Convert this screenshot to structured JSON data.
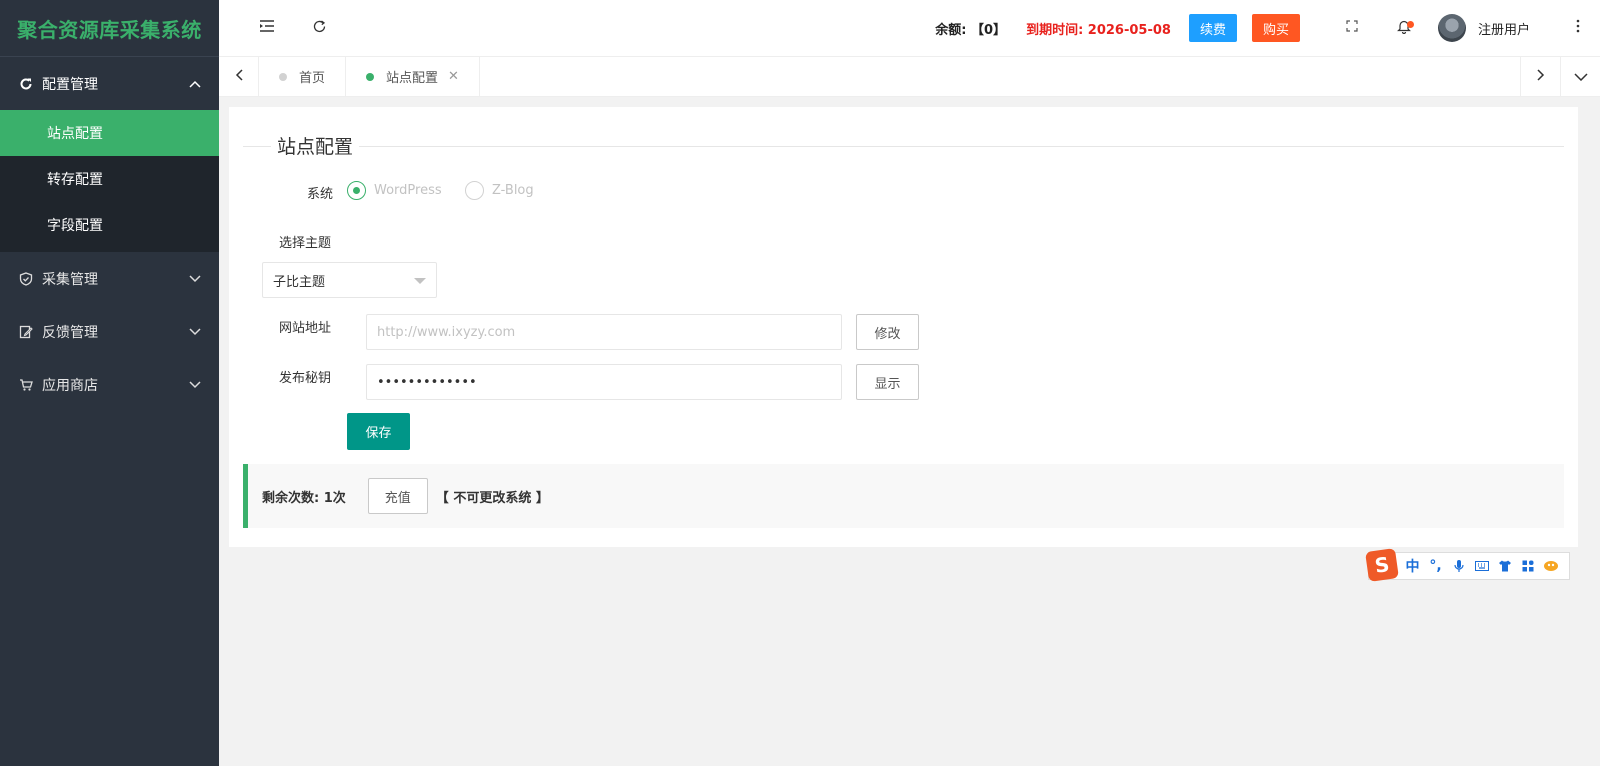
{
  "app": {
    "title": "聚合资源库采集系统"
  },
  "sidebar": {
    "groups": [
      {
        "label": "配置管理",
        "icon": "refresh-icon",
        "expanded": true,
        "items": [
          {
            "label": "站点配置",
            "active": true
          },
          {
            "label": "转存配置",
            "active": false
          },
          {
            "label": "字段配置",
            "active": false
          }
        ]
      },
      {
        "label": "采集管理",
        "icon": "shield-icon",
        "expanded": false
      },
      {
        "label": "反馈管理",
        "icon": "edit-doc-icon",
        "expanded": false
      },
      {
        "label": "应用商店",
        "icon": "cart-icon",
        "expanded": false
      }
    ]
  },
  "header": {
    "balance_text": "余额: 【0】",
    "expire_text": "到期时间: 2026-05-08",
    "renew_label": "续费",
    "buy_label": "购买",
    "username": "注册用户",
    "colors": {
      "renew": "#1e9fff",
      "buy": "#ff5722",
      "expire": "#e8221e"
    }
  },
  "tabs": {
    "items": [
      {
        "label": "首页",
        "active": false
      },
      {
        "label": "站点配置",
        "active": true,
        "closable": true
      }
    ]
  },
  "form": {
    "section_title": "站点配置",
    "system_label": "系统",
    "system_options": [
      {
        "label": "WordPress",
        "checked": true
      },
      {
        "label": "Z-Blog",
        "checked": false
      }
    ],
    "theme_label": "选择主题",
    "theme_value": "子比主题",
    "site_url_label": "网站地址",
    "site_url_placeholder": "http://www.ixyzy.com",
    "site_url_value": "",
    "modify_label": "修改",
    "secret_label": "发布秘钥",
    "secret_value": "•••••••••••••",
    "show_label": "显示",
    "save_label": "保存"
  },
  "notice": {
    "remain_text": "剩余次数: 1次",
    "recharge_label": "充值",
    "note_text": "【 不可更改系统 】"
  },
  "ime": {
    "logo": "S",
    "items": [
      "中",
      "°,",
      "mic-icon",
      "keyboard-icon",
      "shirt-icon",
      "grid-icon",
      "tool-icon"
    ]
  },
  "accent_color": "#3ab06b"
}
